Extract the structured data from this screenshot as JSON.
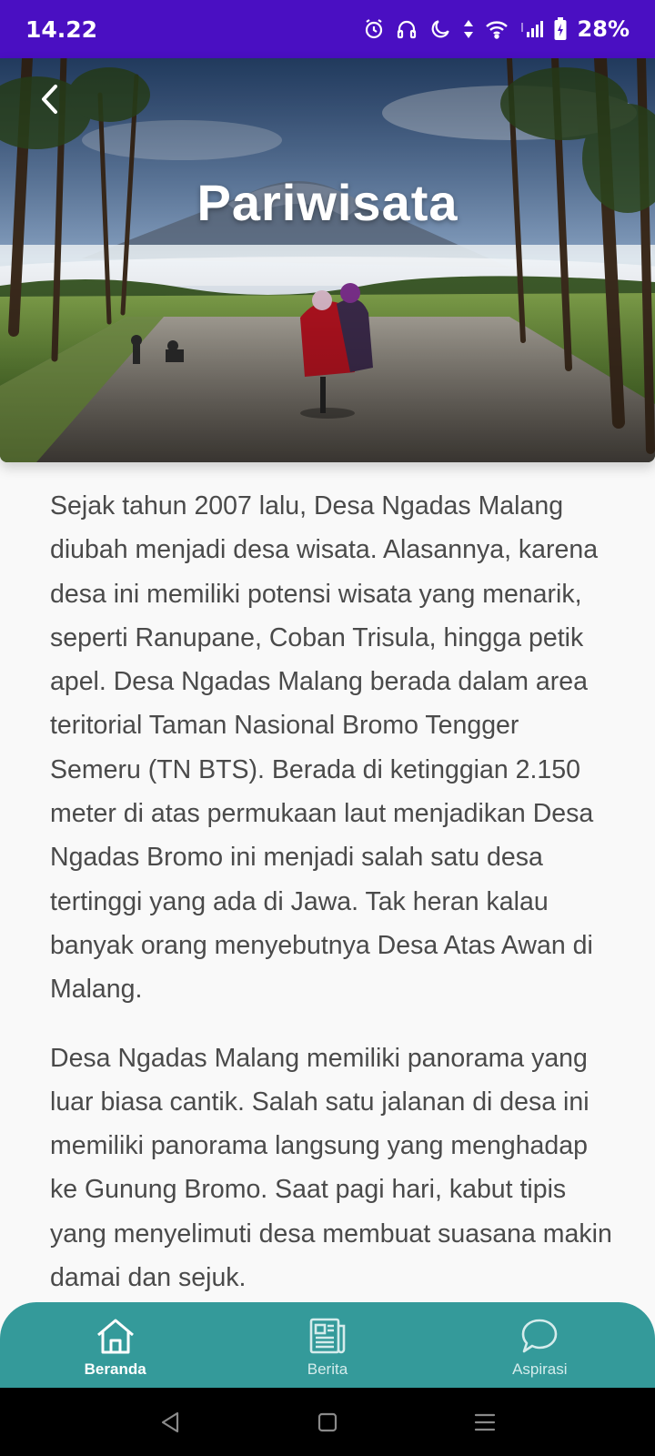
{
  "status_bar": {
    "time": "14.22",
    "battery": "28%",
    "icons": [
      "alarm-icon",
      "headphones-icon",
      "moon-icon",
      "data-arrows-icon",
      "wifi-icon",
      "signal-icon",
      "battery-icon"
    ]
  },
  "hero": {
    "title": "Pariwisata",
    "back_icon": "chevron-left-icon"
  },
  "article": {
    "paragraphs": [
      "Sejak tahun 2007 lalu, Desa Ngadas Malang diubah menjadi desa wisata. Alasannya, karena desa ini memiliki potensi wisata yang menarik, seperti Ranupane, Coban Trisula, hingga petik apel. Desa Ngadas Malang berada dalam area teritorial Taman Nasional Bromo Tengger Semeru (TN BTS). Berada di ketinggian 2.150 meter di atas permukaan laut menjadikan Desa Ngadas Bromo ini menjadi salah satu desa tertinggi yang ada di Jawa. Tak heran kalau banyak orang menyebutnya Desa Atas Awan di Malang.",
      "Desa Ngadas Malang memiliki panorama yang luar biasa cantik. Salah satu jalanan di desa ini memiliki panorama langsung yang menghadap ke Gunung Bromo. Saat pagi hari, kabut tipis yang menyelimuti desa membuat suasana makin damai dan sejuk."
    ]
  },
  "bottom_nav": {
    "items": [
      {
        "label": "Beranda",
        "icon": "home-icon",
        "active": true
      },
      {
        "label": "Berita",
        "icon": "news-icon",
        "active": false
      },
      {
        "label": "Aspirasi",
        "icon": "chat-bubble-icon",
        "active": false
      }
    ]
  },
  "system_nav": {
    "icons": [
      "back-triangle-icon",
      "home-square-icon",
      "recents-lines-icon"
    ]
  },
  "colors": {
    "status_bar": "#4a0fc2",
    "nav_bar": "#349a9a",
    "background": "#f9f9f9",
    "text": "#4a4a4a"
  }
}
